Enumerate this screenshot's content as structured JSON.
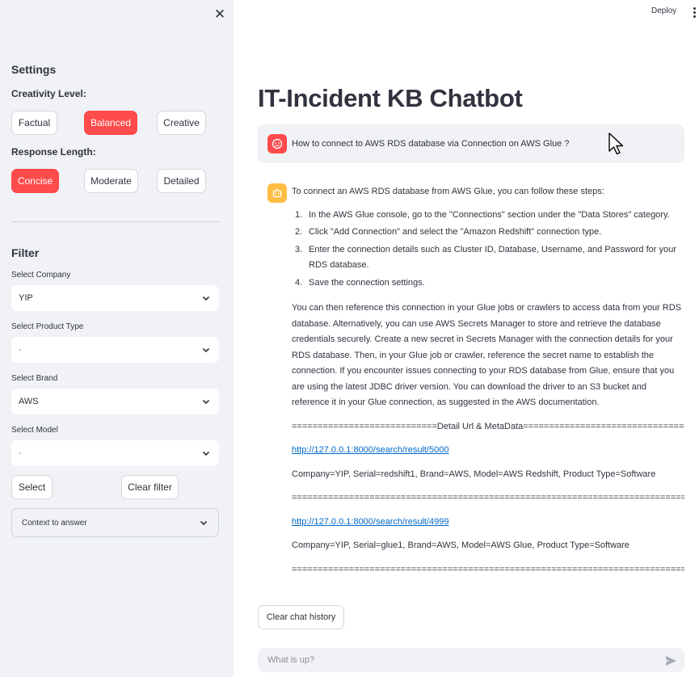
{
  "sidebar": {
    "close_icon": "close-icon",
    "settings_title": "Settings",
    "creativity": {
      "label": "Creativity Level:",
      "options": [
        "Factual",
        "Balanced",
        "Creative"
      ],
      "selected": "Balanced"
    },
    "response_length": {
      "label": "Response Length:",
      "options": [
        "Concise",
        "Moderate",
        "Detailed"
      ],
      "selected": "Concise"
    },
    "filter_title": "Filter",
    "selects": [
      {
        "label": "Select Company",
        "value": "YIP"
      },
      {
        "label": "Select Product Type",
        "value": "-"
      },
      {
        "label": "Select Brand",
        "value": "AWS"
      },
      {
        "label": "Select Model",
        "value": "-"
      }
    ],
    "select_button": "Select",
    "clear_filter_button": "Clear filter",
    "context_expander": "Context to answer",
    "accent_color": "#ff4b4b"
  },
  "header": {
    "deploy": "Deploy"
  },
  "main": {
    "title": "IT-Incident KB Chatbot",
    "user_message": "How to connect to AWS RDS database via Connection on AWS Glue ?",
    "bot": {
      "intro": "To connect an AWS RDS database from AWS Glue, you can follow these steps:",
      "steps": [
        {
          "num": "1.",
          "text": "In the AWS Glue console, go to the \"Connections\" section under the \"Data Stores\" category."
        },
        {
          "num": "2.",
          "text": "Click \"Add Connection\" and select the \"Amazon Redshift\" connection type."
        },
        {
          "num": "3.",
          "text": "Enter the connection details such as Cluster ID, Database, Username, and Password for your RDS database."
        },
        {
          "num": "4.",
          "text": "Save the connection settings."
        }
      ],
      "paragraph": "You can then reference this connection in your Glue jobs or crawlers to access data from your RDS database. Alternatively, you can use AWS Secrets Manager to store and retrieve the database credentials securely. Create a new secret in Secrets Manager with the connection details for your RDS database. Then, in your Glue job or crawler, reference the secret name to establish the connection. If you encounter issues connecting to your RDS database from Glue, ensure that you are using the latest JDBC driver version. You can download the driver to an S3 bucket and reference it in your Glue connection, as suggested in the AWS documentation.",
      "meta_header": "============================Detail Url & MetaData=====================================",
      "link1": "http://127.0.0.1:8000/search/result/5000",
      "meta1": "Company=YIP, Serial=redshift1, Brand=AWS, Model=AWS Redshift, Product Type=Software",
      "separator": "==========================================================================================",
      "link2": "http://127.0.0.1:8000/search/result/4999",
      "meta2": "Company=YIP, Serial=glue1, Brand=AWS, Model=AWS Glue, Product Type=Software",
      "separator_end": "=========================================================================================="
    },
    "clear_chat_button": "Clear chat history",
    "chat_input_placeholder": "What is up?"
  }
}
